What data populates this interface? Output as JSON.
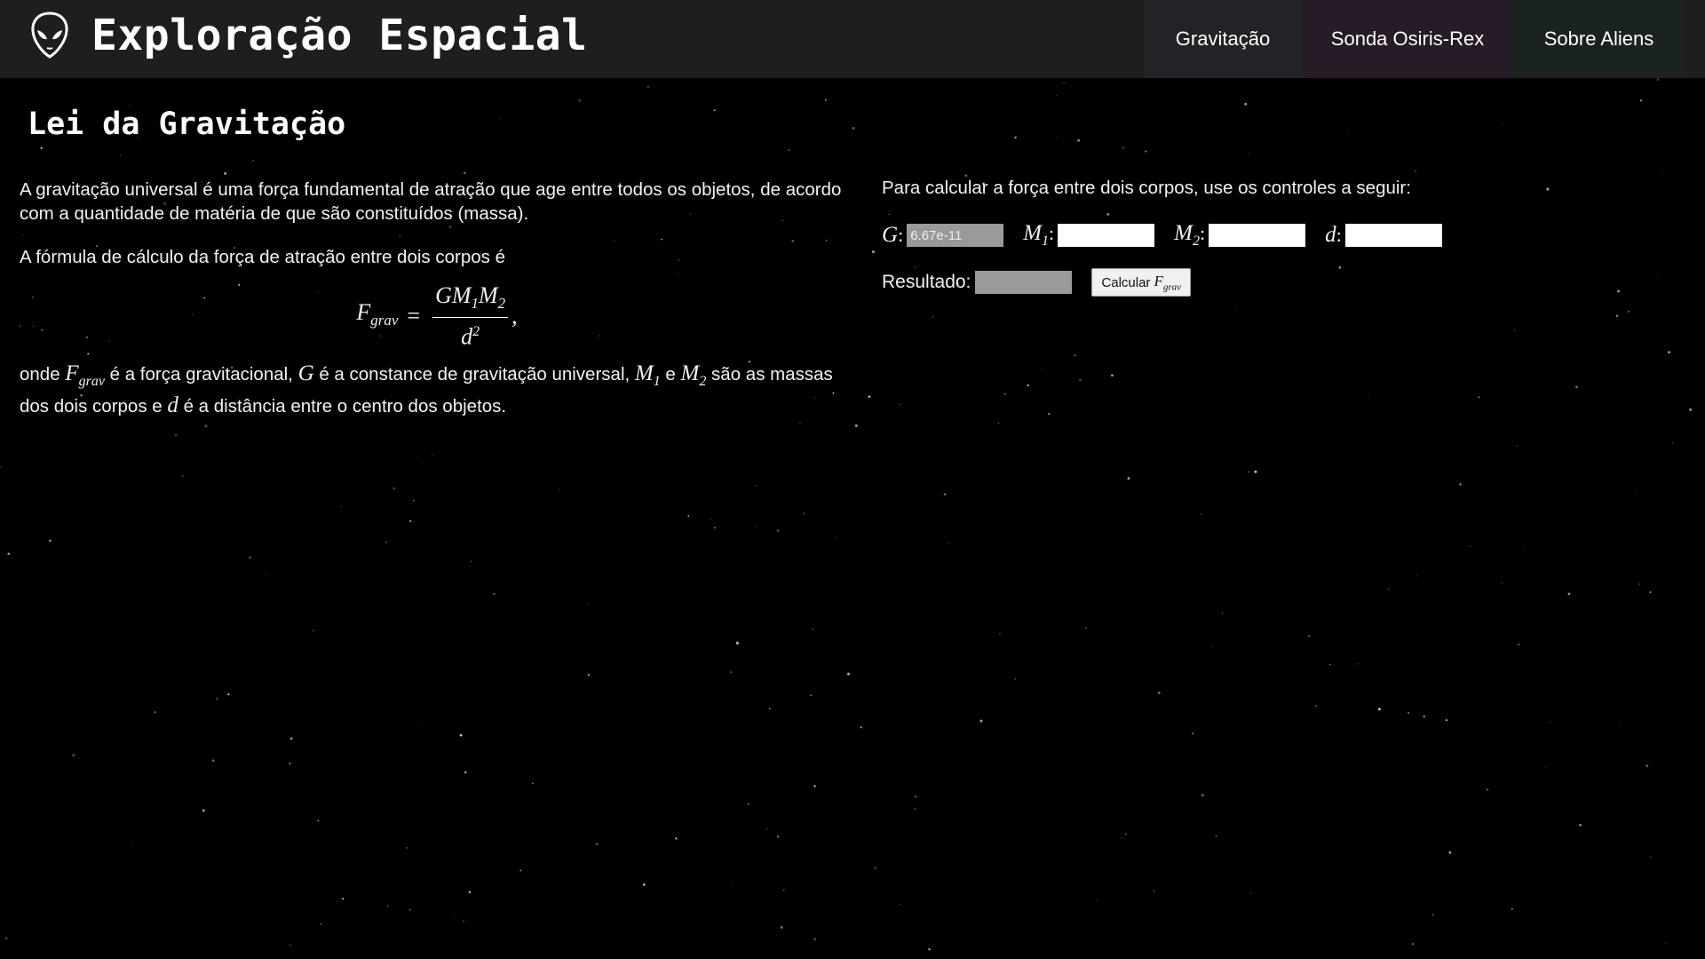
{
  "header": {
    "title": "Exploração Espacial",
    "logo_icon": "alien-head-icon",
    "nav": [
      {
        "label": "Gravitação"
      },
      {
        "label": "Sonda Osiris-Rex"
      },
      {
        "label": "Sobre Aliens"
      }
    ]
  },
  "main": {
    "section_title": "Lei da Gravitação",
    "left": {
      "p1": "A gravitação universal é uma força fundamental de atração que age entre todos os objetos, de acordo com a quantidade de matéria de que são constituídos (massa).",
      "p2": "A fórmula de cálculo da força de atração entre dois corpos é",
      "formula": {
        "lhs": "F",
        "lhs_sub": "grav",
        "num": "GM",
        "num_sub1": "1",
        "num_mid": "M",
        "num_sub2": "2",
        "den": "d",
        "den_sup": "2"
      },
      "p3_parts": [
        "onde ",
        " é a força gravitacional, ",
        " é a constance de gravitação universal, ",
        " e ",
        " são as massas dos dois corpos e ",
        " é a distância entre o centro dos objetos."
      ]
    },
    "right": {
      "intro": "Para calcular a força entre dois corpos, use os controles a seguir:",
      "g_value": "6.67e-11",
      "m1_value": "",
      "m2_value": "",
      "d_value": "",
      "result_label": "Resultado:",
      "button_label": "Calcular"
    }
  },
  "colors": {
    "background": "#000000",
    "header": "#1e1e1e",
    "nav_gravitacao": "#222327",
    "nav_sonda": "#261b26",
    "nav_aliens": "#1a231d"
  }
}
